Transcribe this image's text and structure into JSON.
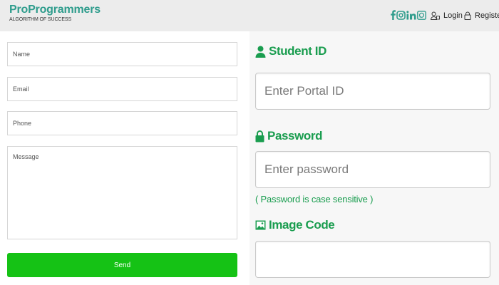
{
  "header": {
    "brand_name": "ProProgrammers",
    "tagline": "ALGORITHM OF SUCCESS",
    "social_icons": [
      "facebook-icon",
      "instagram-icon",
      "linkedin-icon",
      "whatsapp-icon"
    ],
    "login_label": "Login",
    "register_label": "Register"
  },
  "contact_form": {
    "name_placeholder": "Name",
    "email_placeholder": "Email",
    "phone_placeholder": "Phone",
    "message_placeholder": "Message",
    "send_label": "Send"
  },
  "login_panel": {
    "student_id_label": "Student ID",
    "portal_placeholder": "Enter Portal ID",
    "password_label": "Password",
    "password_placeholder": "Enter password",
    "password_hint": "( Password is case sensitive )",
    "image_code_label": "Image Code"
  },
  "colors": {
    "brand": "#2e9c8c",
    "accent_green": "#1a9d4f",
    "send_button": "#15c215"
  }
}
